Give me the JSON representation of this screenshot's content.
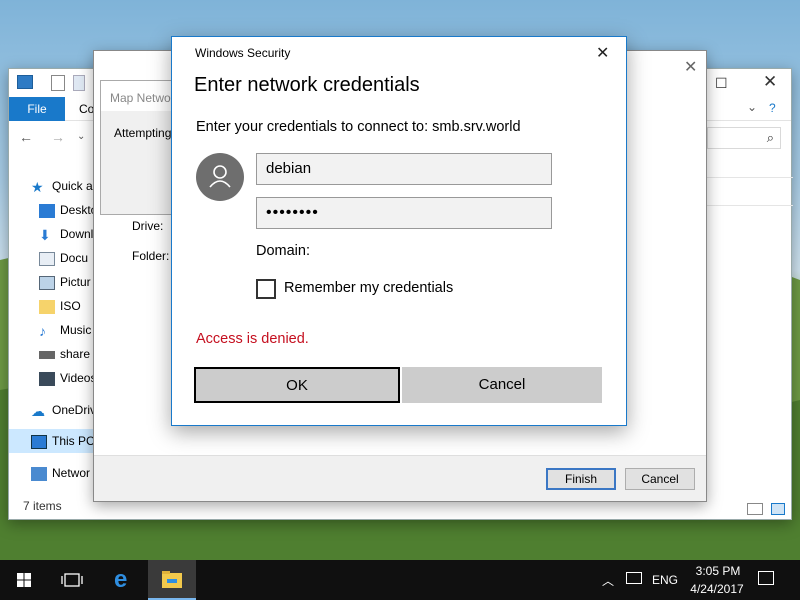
{
  "explorer": {
    "file_tab": "File",
    "ribbon_partial": "Co",
    "sidebar": [
      {
        "label": "Quick a"
      },
      {
        "label": "Deskto"
      },
      {
        "label": "Downl"
      },
      {
        "label": "Docu"
      },
      {
        "label": "Pictur"
      },
      {
        "label": "ISO"
      },
      {
        "label": "Music"
      },
      {
        "label": "share"
      },
      {
        "label": "Videos"
      },
      {
        "label": "OneDriv"
      },
      {
        "label": "This PC"
      },
      {
        "label": "Networ"
      }
    ],
    "status": "7 items"
  },
  "wizard": {
    "drive_label": "Drive:",
    "folder_label": "Folder:",
    "finish": "Finish",
    "cancel": "Cancel"
  },
  "progress": {
    "title": "Map Netwo",
    "text": "Attempting"
  },
  "security": {
    "window_title": "Windows Security",
    "heading": "Enter network credentials",
    "prompt": "Enter your credentials to connect to: smb.srv.world",
    "username": "debian",
    "password_masked": "••••••••",
    "domain_label": "Domain:",
    "remember_label": "Remember my credentials",
    "error": "Access is denied.",
    "ok": "OK",
    "cancel": "Cancel",
    "error_color": "#c50f1f",
    "accent_color": "#1979ca"
  },
  "taskbar": {
    "time": "3:05 PM",
    "date": "4/24/2017",
    "language": "ENG"
  }
}
